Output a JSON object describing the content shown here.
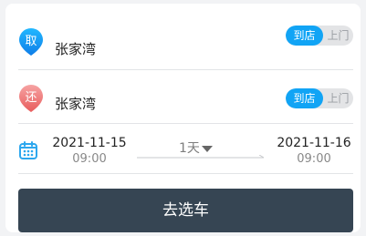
{
  "pickup": {
    "badge": "取",
    "location": "张家湾",
    "toggle_on": "到店",
    "toggle_off": "上门"
  },
  "return": {
    "badge": "还",
    "location": "张家湾",
    "toggle_on": "到店",
    "toggle_off": "上门"
  },
  "schedule": {
    "pickup_date": "2021-11-15",
    "pickup_time": "09:00",
    "duration": "1天",
    "return_date": "2021-11-16",
    "return_time": "09:00"
  },
  "action": {
    "select_label": "去选车"
  },
  "colors": {
    "pickup_pin": "#1098f5",
    "return_pin": "#ef7f7f",
    "toggle_active": "#11a4f5",
    "button_bg": "#364553"
  },
  "icons": {
    "pickup": "map-pin-icon",
    "return": "map-pin-icon",
    "calendar": "calendar-icon",
    "duration": "chevron-down-icon"
  }
}
